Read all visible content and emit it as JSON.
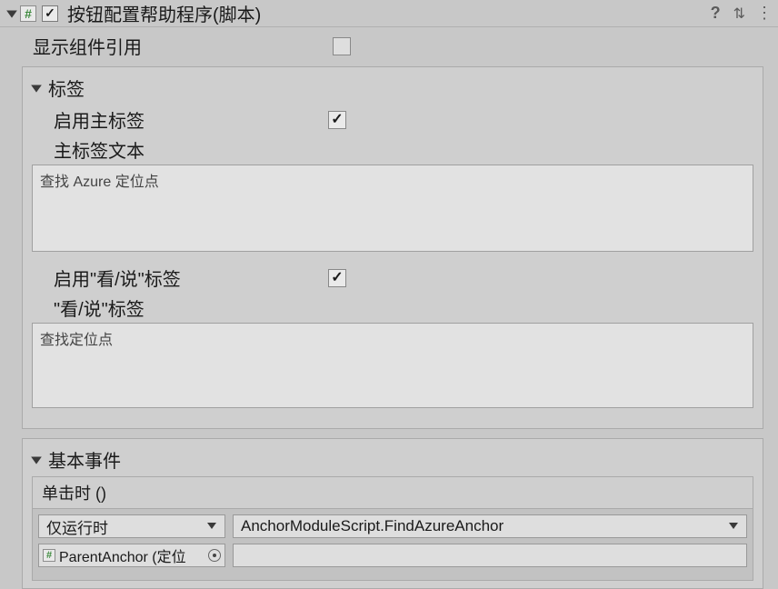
{
  "header": {
    "title": "按钮配置帮助程序(脚本)",
    "enabled": true
  },
  "show_refs": {
    "label": "显示组件引用"
  },
  "labels_group": {
    "title": "标签",
    "enable_main": {
      "label": "启用主标签",
      "checked": true
    },
    "main_text_label": "主标签文本",
    "main_text_value": "查找 Azure 定位点",
    "enable_seesay": {
      "label": "启用\"看/说\"标签",
      "checked": true
    },
    "seesay_text_label": "\"看/说\"标签",
    "seesay_text_value": "查找定位点"
  },
  "events_group": {
    "title": "基本事件",
    "event_label": "单击时 ()",
    "runtime": "仅运行时",
    "function": "AnchorModuleScript.FindAzureAnchor",
    "target": "ParentAnchor (定位"
  }
}
